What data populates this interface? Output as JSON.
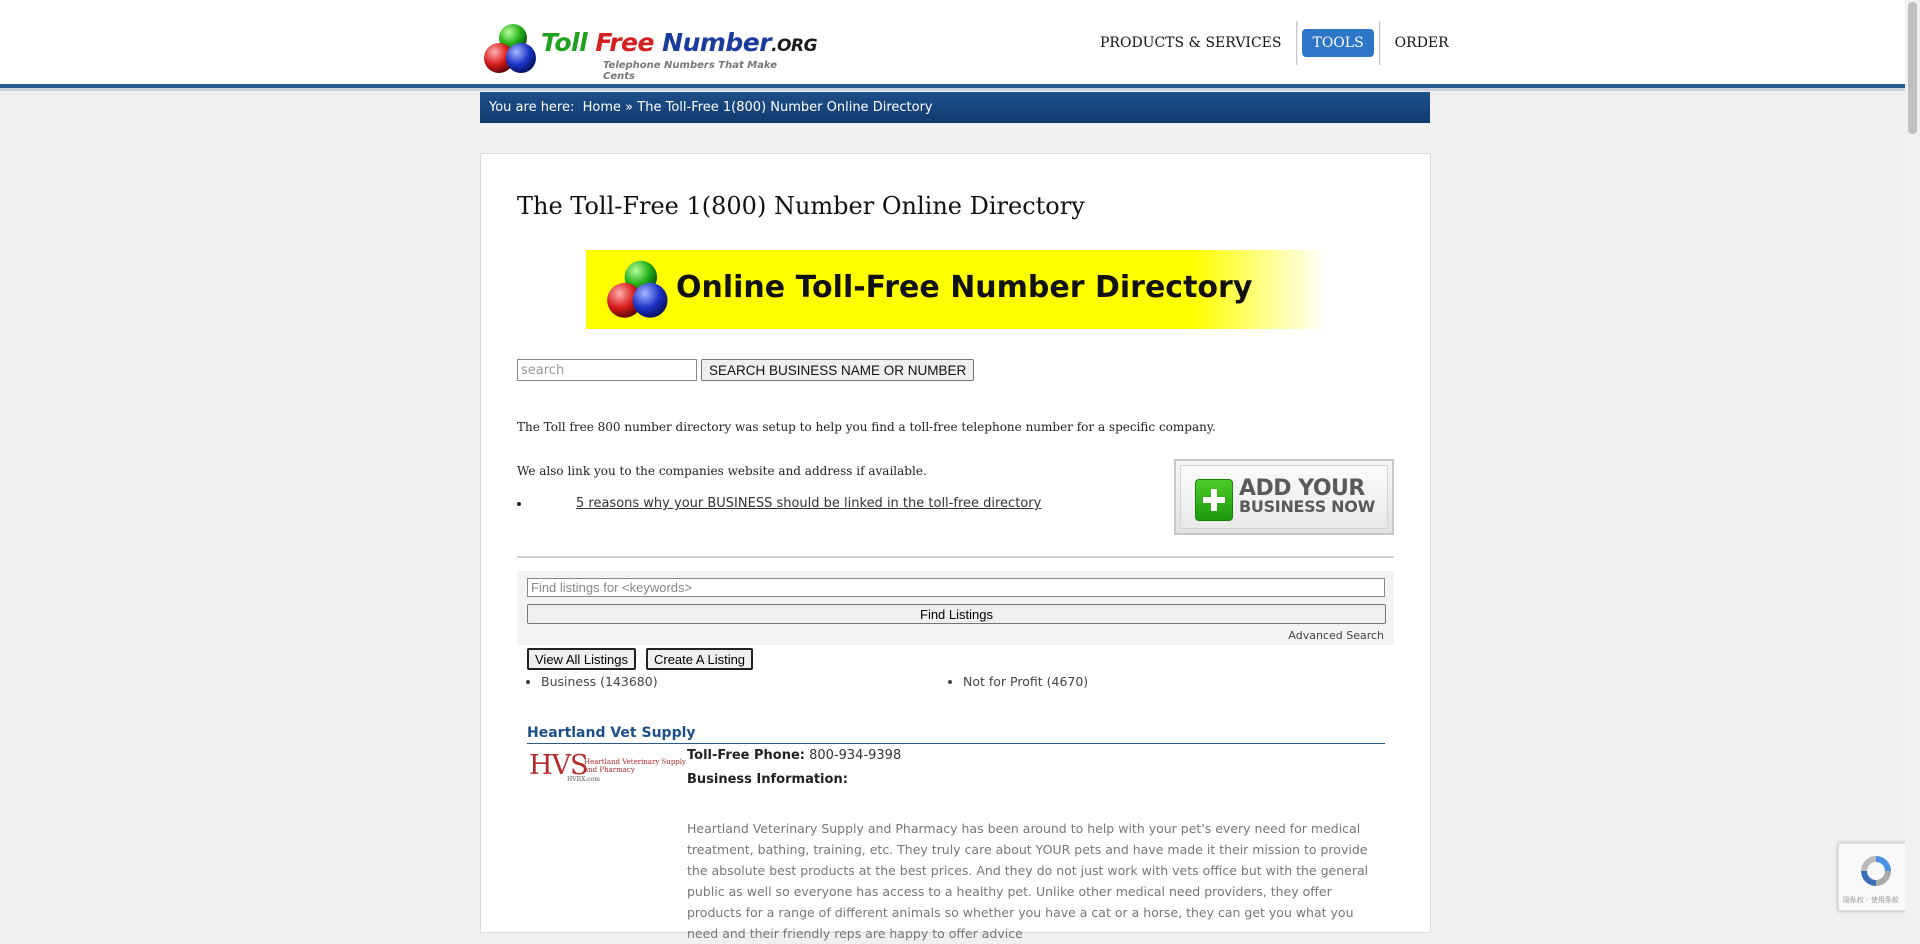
{
  "header": {
    "logo": {
      "word1": "Toll ",
      "word2": "Free ",
      "word3": "Number",
      "word4": ".ORG",
      "tagline": "Telephone Numbers That Make Cents"
    },
    "nav": [
      {
        "label": "PRODUCTS & SERVICES"
      },
      {
        "label": "TOOLS",
        "active": true
      },
      {
        "label": "ORDER"
      }
    ]
  },
  "breadcrumb": {
    "prefix": "You are here:",
    "home": "Home",
    "separator": "»",
    "current": "The Toll-Free 1(800) Number Online Directory"
  },
  "main": {
    "title": "The Toll-Free 1(800) Number Online Directory",
    "banner_text": "Online Toll-Free Number Directory",
    "search_placeholder": "search",
    "search_button": "SEARCH BUSINESS NAME OR NUMBER",
    "intro1": "The Toll free 800 number directory was setup to help you find a toll-free telephone number for a specific company.",
    "intro2": "We also link you to the companies website and address if available.",
    "reasons_link": "5 reasons why your BUSINESS should be linked in the toll-free directory",
    "add_business": {
      "line1": "ADD YOUR",
      "line2": "BUSINESS NOW"
    },
    "find": {
      "placeholder": "Find listings for <keywords>",
      "button": "Find Listings",
      "advanced": "Advanced Search"
    },
    "view_all": "View All Listings",
    "create": "Create A Listing",
    "categories": [
      {
        "label": "Business (143680)"
      },
      {
        "label": "Not for Profit (4670)"
      }
    ],
    "listing": {
      "name": "Heartland Vet Supply",
      "logo_big": "HVS",
      "logo_line1": "Heartland Veterinary Supply",
      "logo_line2": "and Pharmacy",
      "logo_url": "HVRX.com",
      "phone_label": "Toll-Free Phone:",
      "phone": "800-934-9398",
      "info_label": "Business Information:",
      "description": "Heartland Veterinary Supply and Pharmacy has been around to help with your pet's every need for medical treatment, bathing, training, etc. They truly care about YOUR pets and have made it their mission to provide the absolute best products at the best prices. And they do not just work with vets office but with the general public as well so everyone has access to a healthy pet. Unlike other medical need providers, they offer products for a range of different animals so whether you have a cat or a horse, they can get you what you need and their friendly reps are happy to offer advice"
    }
  },
  "recaptcha": {
    "footer": "隐私权 - 使用条款"
  },
  "colors": {
    "brand_blue": "#1d4f8a",
    "nav_active": "#2e77c8",
    "banner_yellow": "#ffff00",
    "logo_green": "#22a020",
    "logo_red": "#d42020"
  }
}
